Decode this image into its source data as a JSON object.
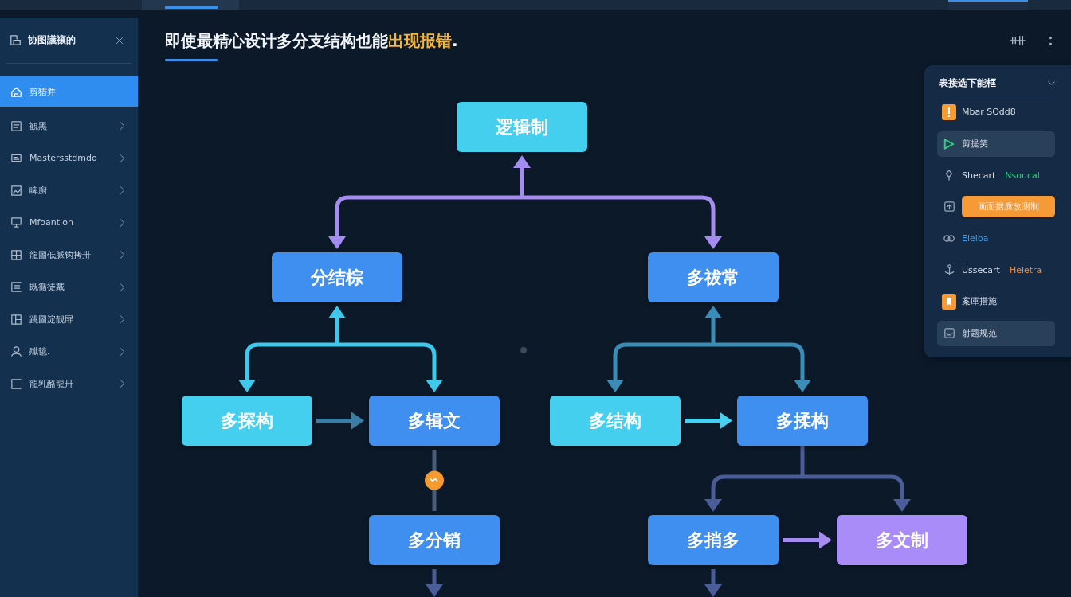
{
  "sidebar": {
    "title": "协图議禳的",
    "items": [
      {
        "label": "剪猎并",
        "selected": true,
        "submenu": false
      },
      {
        "label": "観黑",
        "selected": false,
        "submenu": true
      },
      {
        "label": "Mastersstdmdo",
        "selected": false,
        "submenu": true
      },
      {
        "label": "睥廚",
        "selected": false,
        "submenu": true
      },
      {
        "label": "Mfoantion",
        "selected": false,
        "submenu": true
      },
      {
        "label": "龍圖低脈钩拷卅",
        "selected": false,
        "submenu": true
      },
      {
        "label": "既循徒戴",
        "selected": false,
        "submenu": true
      },
      {
        "label": "跳圖淀靓屝",
        "selected": false,
        "submenu": true
      },
      {
        "label": "殲毯.",
        "selected": false,
        "submenu": true
      },
      {
        "label": "龍乳酪龍卅",
        "selected": false,
        "submenu": true
      }
    ]
  },
  "header": {
    "title": [
      {
        "text": "即使最精心设计多分支结构也能",
        "highlight": false
      },
      {
        "text": "出现报错",
        "highlight": true
      },
      {
        "text": ".",
        "highlight": false
      }
    ]
  },
  "panel": {
    "title": "表接选下能框",
    "items": [
      {
        "kind": "tile",
        "label": "Mbar SOdd8"
      },
      {
        "kind": "filled",
        "label": "剪提笑"
      },
      {
        "kind": "plain",
        "label": "Shecart",
        "tag": {
          "text": "Nsoucal",
          "color": "#2fcf7f"
        }
      },
      {
        "kind": "button",
        "label": "画面据质改测制"
      },
      {
        "kind": "plain",
        "tag": {
          "text": "Eleiba",
          "color": "#3a9be6"
        }
      },
      {
        "kind": "plain",
        "label": "Ussecart",
        "tag": {
          "text": "Heletra",
          "color": "#f28a3a"
        }
      },
      {
        "kind": "tile",
        "label": "案庫措施"
      },
      {
        "kind": "filled",
        "label": "射题规范"
      }
    ]
  },
  "diagram": {
    "root": {
      "label": "逻辑制",
      "color": "#44cfee",
      "link": {
        "kind": "branch",
        "color": "#a48cf0",
        "head_at_parent": true
      },
      "children": [
        {
          "label": "分结棕",
          "color": "#3f8ff0",
          "link": {
            "kind": "branch",
            "color": "#3ec9ec",
            "head_at_parent": true
          },
          "children": [
            {
              "label": "多探构",
              "color": "#44cfee",
              "arrow_next": {
                "color": "#3a7ea6"
              }
            },
            {
              "label": "多辑文",
              "color": "#3f8ff0",
              "link": {
                "kind": "marked",
                "color": "#4b5c78"
              },
              "children": [
                {
                  "label": "多分销",
                  "color": "#3f8ff0",
                  "exit": {
                    "color": "#4a5d98"
                  }
                }
              ]
            }
          ]
        },
        {
          "label": "多祓常",
          "color": "#3f8ff0",
          "link": {
            "kind": "branch",
            "color": "#3b8db8",
            "head_at_parent": true
          },
          "children": [
            {
              "label": "多结构",
              "color": "#44cfee",
              "arrow_next": {
                "color": "#48d0f0"
              }
            },
            {
              "label": "多揉构",
              "color": "#3f8ff0",
              "link": {
                "kind": "branch",
                "color": "#4a5d98",
                "head_at_parent": false
              },
              "children": [
                {
                  "label": "多捎多",
                  "color": "#3f8ff0",
                  "arrow_next": {
                    "color": "#a48cf0"
                  },
                  "exit": {
                    "color": "#4a5d98"
                  }
                },
                {
                  "label": "多文制",
                  "color": "#a98cf7"
                }
              ]
            }
          ]
        }
      ]
    }
  }
}
